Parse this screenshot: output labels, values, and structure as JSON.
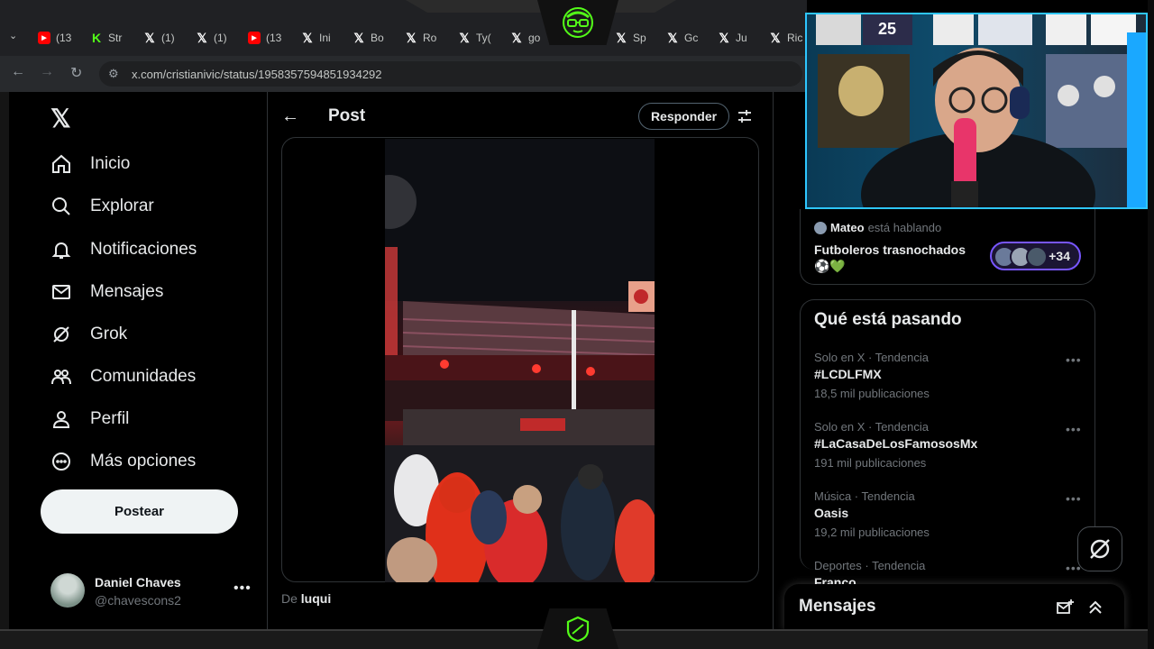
{
  "browser": {
    "tabs": [
      {
        "icon": "youtube-icon",
        "label": "(13"
      },
      {
        "icon": "kick-icon",
        "label": "Str"
      },
      {
        "icon": "x-icon",
        "label": "(1)"
      },
      {
        "icon": "x-icon",
        "label": "(1)"
      },
      {
        "icon": "youtube-icon",
        "label": "(13"
      },
      {
        "icon": "x-icon",
        "label": "Ini"
      },
      {
        "icon": "x-icon",
        "label": "Bo"
      },
      {
        "icon": "x-icon",
        "label": "Ro"
      },
      {
        "icon": "x-icon",
        "label": "Ty("
      },
      {
        "icon": "x-icon",
        "label": "go"
      },
      {
        "icon": "x-icon",
        "label": "Sp"
      },
      {
        "icon": "x-icon",
        "label": "Gc"
      },
      {
        "icon": "x-icon",
        "label": "Ju"
      },
      {
        "icon": "x-icon",
        "label": "Ric"
      }
    ],
    "url": "x.com/cristianivic/status/1958357594851934292"
  },
  "sidebar": {
    "items": [
      {
        "label": "Inicio",
        "icon": "home-icon"
      },
      {
        "label": "Explorar",
        "icon": "search-icon"
      },
      {
        "label": "Notificaciones",
        "icon": "bell-icon"
      },
      {
        "label": "Mensajes",
        "icon": "mail-icon"
      },
      {
        "label": "Grok",
        "icon": "grok-icon"
      },
      {
        "label": "Comunidades",
        "icon": "communities-icon"
      },
      {
        "label": "Perfil",
        "icon": "person-icon"
      },
      {
        "label": "Más opciones",
        "icon": "more-circle-icon"
      }
    ],
    "post_button": "Postear",
    "profile": {
      "name": "Daniel Chaves",
      "handle": "@chavescons2"
    }
  },
  "main": {
    "title": "Post",
    "reply_button": "Responder",
    "from_prefix": "De",
    "from_user": "luqui"
  },
  "spaces": {
    "host": "Mateo",
    "host_suffix": "está hablando",
    "title": "Futboleros trasnochados",
    "emoji": "⚽💚",
    "listener_count": "+34"
  },
  "trends": {
    "title": "Qué está pasando",
    "items": [
      {
        "meta": "Solo en X · Tendencia",
        "name": "#LCDLFMX",
        "count": "18,5 mil publicaciones"
      },
      {
        "meta": "Solo en X · Tendencia",
        "name": "#LaCasaDeLosFamososMx",
        "count": "191 mil publicaciones"
      },
      {
        "meta": "Música · Tendencia",
        "name": "Oasis",
        "count": "19,2 mil publicaciones"
      },
      {
        "meta": "Deportes · Tendencia",
        "name": "Franco",
        "count": ""
      }
    ]
  },
  "messages_drawer": {
    "title": "Mensajes"
  },
  "colors": {
    "accent": "#1d9bf0",
    "spaces_purple": "#7856ff",
    "text": "#e7e9ea",
    "muted": "#71767b"
  }
}
